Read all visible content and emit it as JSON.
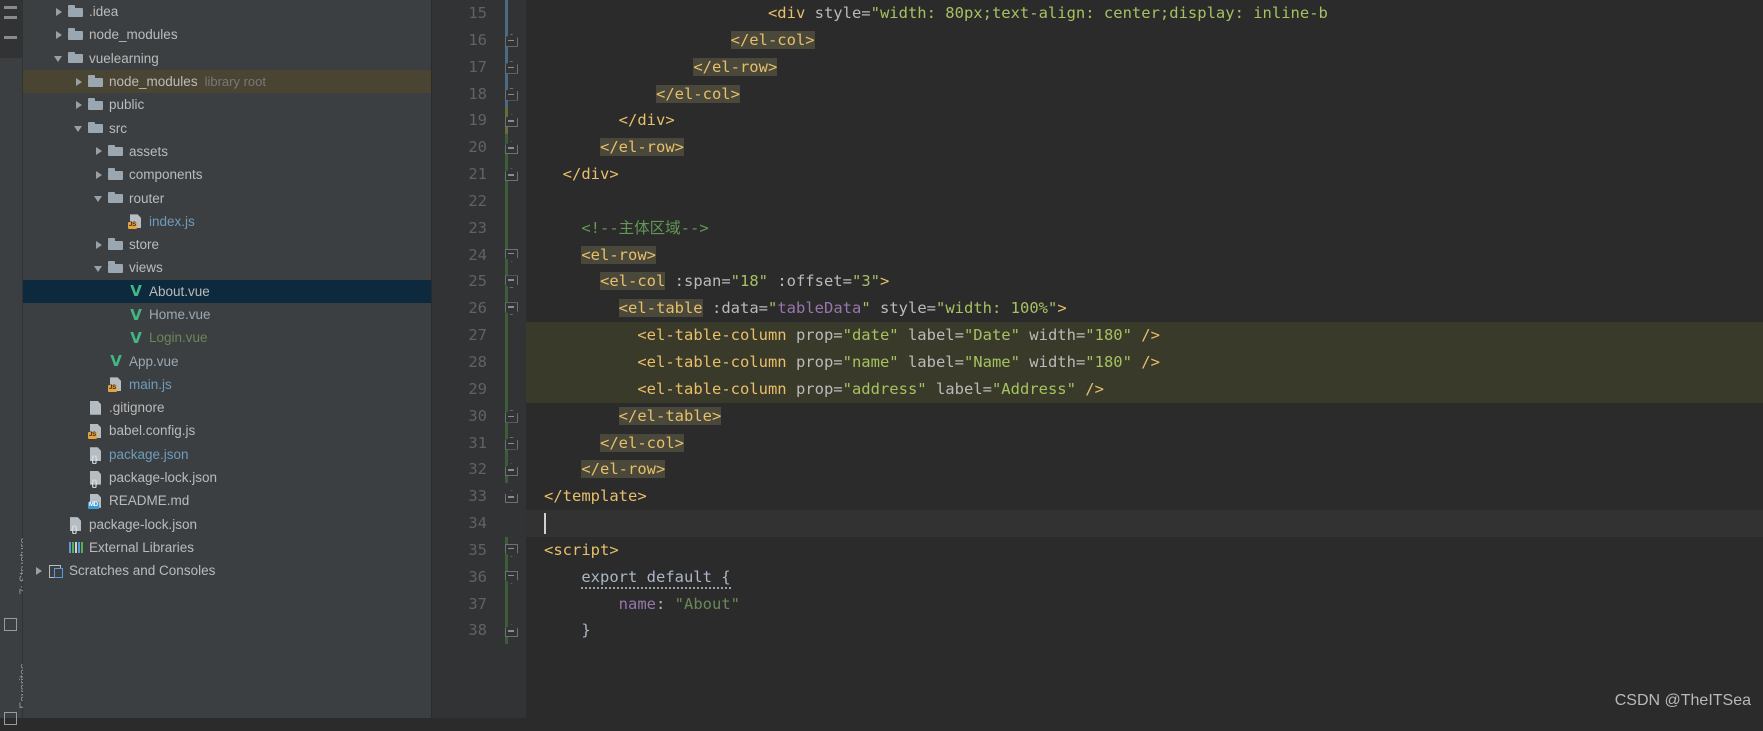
{
  "window": {
    "theme_background": "#3c3f41",
    "editor_background": "#2b2b2b",
    "accent_selection": "#0d293e",
    "accent_library_highlight": "#4a4433"
  },
  "tool_strip": {
    "labels": {
      "structure": "7: Structure",
      "favorites": "Favorites"
    }
  },
  "project_tree": {
    "items": [
      {
        "label": ".idea",
        "sublabel": "",
        "indent": 1,
        "twisty": "right",
        "icon": "folder-icon",
        "color": "default",
        "state": "normal"
      },
      {
        "label": "node_modules",
        "sublabel": "",
        "indent": 1,
        "twisty": "right",
        "icon": "folder-icon",
        "color": "default",
        "state": "normal"
      },
      {
        "label": "vuelearning",
        "sublabel": "",
        "indent": 1,
        "twisty": "down",
        "icon": "folder-icon",
        "color": "default",
        "state": "normal"
      },
      {
        "label": "node_modules",
        "sublabel": "library root",
        "indent": 2,
        "twisty": "right",
        "icon": "folder-icon",
        "color": "default",
        "state": "library"
      },
      {
        "label": "public",
        "sublabel": "",
        "indent": 2,
        "twisty": "right",
        "icon": "folder-icon",
        "color": "default",
        "state": "normal"
      },
      {
        "label": "src",
        "sublabel": "",
        "indent": 2,
        "twisty": "down",
        "icon": "folder-icon",
        "color": "default",
        "state": "normal"
      },
      {
        "label": "assets",
        "sublabel": "",
        "indent": 3,
        "twisty": "right",
        "icon": "folder-icon",
        "color": "default",
        "state": "normal"
      },
      {
        "label": "components",
        "sublabel": "",
        "indent": 3,
        "twisty": "right",
        "icon": "folder-icon",
        "color": "default",
        "state": "normal"
      },
      {
        "label": "router",
        "sublabel": "",
        "indent": 3,
        "twisty": "down",
        "icon": "folder-icon",
        "color": "default",
        "state": "normal"
      },
      {
        "label": "index.js",
        "sublabel": "",
        "indent": 4,
        "twisty": "none",
        "icon": "js-file-icon",
        "color": "blue",
        "state": "normal"
      },
      {
        "label": "store",
        "sublabel": "",
        "indent": 3,
        "twisty": "right",
        "icon": "folder-icon",
        "color": "default",
        "state": "normal"
      },
      {
        "label": "views",
        "sublabel": "",
        "indent": 3,
        "twisty": "down",
        "icon": "folder-icon",
        "color": "default",
        "state": "normal"
      },
      {
        "label": "About.vue",
        "sublabel": "",
        "indent": 4,
        "twisty": "none",
        "icon": "vue-file-icon",
        "color": "teal",
        "state": "selected"
      },
      {
        "label": "Home.vue",
        "sublabel": "",
        "indent": 4,
        "twisty": "none",
        "icon": "vue-file-icon",
        "color": "teal",
        "state": "normal"
      },
      {
        "label": "Login.vue",
        "sublabel": "",
        "indent": 4,
        "twisty": "none",
        "icon": "vue-file-icon",
        "color": "green",
        "state": "normal"
      },
      {
        "label": "App.vue",
        "sublabel": "",
        "indent": 3,
        "twisty": "none",
        "icon": "vue-file-icon",
        "color": "teal",
        "state": "normal"
      },
      {
        "label": "main.js",
        "sublabel": "",
        "indent": 3,
        "twisty": "none",
        "icon": "js-file-icon",
        "color": "blue",
        "state": "normal"
      },
      {
        "label": ".gitignore",
        "sublabel": "",
        "indent": 2,
        "twisty": "none",
        "icon": "file-icon",
        "color": "default",
        "state": "normal"
      },
      {
        "label": "babel.config.js",
        "sublabel": "",
        "indent": 2,
        "twisty": "none",
        "icon": "js-file-icon",
        "color": "default",
        "state": "normal"
      },
      {
        "label": "package.json",
        "sublabel": "",
        "indent": 2,
        "twisty": "none",
        "icon": "json-file-icon",
        "color": "blue",
        "state": "normal"
      },
      {
        "label": "package-lock.json",
        "sublabel": "",
        "indent": 2,
        "twisty": "none",
        "icon": "json-file-icon",
        "color": "default",
        "state": "normal"
      },
      {
        "label": "README.md",
        "sublabel": "",
        "indent": 2,
        "twisty": "none",
        "icon": "md-file-icon",
        "color": "default",
        "state": "normal"
      },
      {
        "label": "package-lock.json",
        "sublabel": "",
        "indent": 1,
        "twisty": "none",
        "icon": "json-file-icon",
        "color": "default",
        "state": "normal"
      },
      {
        "label": "External Libraries",
        "sublabel": "",
        "indent": 1,
        "twisty": "none",
        "icon": "libraries-icon",
        "color": "default",
        "state": "normal"
      },
      {
        "label": "Scratches and Consoles",
        "sublabel": "",
        "indent": 0,
        "twisty": "right",
        "icon": "scratches-icon",
        "color": "default",
        "state": "normal"
      }
    ]
  },
  "editor": {
    "first_line_number": 15,
    "current_line": 34,
    "caret_line": 34,
    "lines": [
      {
        "no": 15,
        "fold": "none",
        "rail": "blue",
        "tokens": [
          {
            "t": "                        ",
            "c": "plain"
          },
          {
            "t": "<div",
            "c": "tag"
          },
          {
            "t": " style=",
            "c": "attr"
          },
          {
            "t": "\"width: 80px;text-align: center;display: inline-b",
            "c": "str"
          }
        ]
      },
      {
        "no": 16,
        "fold": "down",
        "rail": "blue",
        "tokens": [
          {
            "t": "                    ",
            "c": "plain"
          },
          {
            "t": "</el-col>",
            "c": "tag",
            "hl": true
          }
        ]
      },
      {
        "no": 17,
        "fold": "down",
        "rail": "blue",
        "tokens": [
          {
            "t": "                ",
            "c": "plain"
          },
          {
            "t": "</el-row>",
            "c": "tag",
            "hl": true
          }
        ]
      },
      {
        "no": 18,
        "fold": "down",
        "rail": "blue",
        "tokens": [
          {
            "t": "            ",
            "c": "plain"
          },
          {
            "t": "</el-col>",
            "c": "tag",
            "hl": true
          }
        ]
      },
      {
        "no": 19,
        "fold": "down",
        "rail": "olive",
        "tokens": [
          {
            "t": "        ",
            "c": "plain"
          },
          {
            "t": "</div>",
            "c": "tag"
          }
        ]
      },
      {
        "no": 20,
        "fold": "down",
        "rail": "green",
        "tokens": [
          {
            "t": "      ",
            "c": "plain"
          },
          {
            "t": "</el-row>",
            "c": "tag",
            "hl": true
          }
        ]
      },
      {
        "no": 21,
        "fold": "down",
        "rail": "green",
        "tokens": [
          {
            "t": "  ",
            "c": "plain"
          },
          {
            "t": "</div>",
            "c": "tag"
          }
        ]
      },
      {
        "no": 22,
        "fold": "none",
        "rail": "green",
        "tokens": []
      },
      {
        "no": 23,
        "fold": "none",
        "rail": "green",
        "tokens": [
          {
            "t": "    ",
            "c": "plain"
          },
          {
            "t": "<!--主体区域-->",
            "c": "cmt"
          }
        ]
      },
      {
        "no": 24,
        "fold": "up",
        "rail": "green",
        "tokens": [
          {
            "t": "    ",
            "c": "plain"
          },
          {
            "t": "<el-row>",
            "c": "tag",
            "hl": true
          }
        ]
      },
      {
        "no": 25,
        "fold": "up",
        "rail": "green",
        "tokens": [
          {
            "t": "      ",
            "c": "plain"
          },
          {
            "t": "<el-col",
            "c": "tag",
            "hl": true
          },
          {
            "t": " :span=",
            "c": "attr"
          },
          {
            "t": "\"18\"",
            "c": "str"
          },
          {
            "t": " :offset=",
            "c": "attr"
          },
          {
            "t": "\"3\"",
            "c": "str"
          },
          {
            "t": ">",
            "c": "tag"
          }
        ]
      },
      {
        "no": 26,
        "fold": "up",
        "rail": "green",
        "tokens": [
          {
            "t": "        ",
            "c": "plain"
          },
          {
            "t": "<el-table",
            "c": "tag",
            "hl": true
          },
          {
            "t": " :data=",
            "c": "attr"
          },
          {
            "t": "\"",
            "c": "str"
          },
          {
            "t": "tableData",
            "c": "expr"
          },
          {
            "t": "\"",
            "c": "str"
          },
          {
            "t": " style=",
            "c": "attr"
          },
          {
            "t": "\"width: 100%\"",
            "c": "str"
          },
          {
            "t": ">",
            "c": "tag"
          }
        ]
      },
      {
        "no": 27,
        "fold": "none",
        "rail": "green",
        "hl_full": true,
        "tokens": [
          {
            "t": "          ",
            "c": "plain"
          },
          {
            "t": "<el-table-column",
            "c": "tag"
          },
          {
            "t": " prop=",
            "c": "attr"
          },
          {
            "t": "\"date\"",
            "c": "str"
          },
          {
            "t": " label=",
            "c": "attr"
          },
          {
            "t": "\"Date\"",
            "c": "str"
          },
          {
            "t": " width=",
            "c": "attr"
          },
          {
            "t": "\"180\"",
            "c": "str"
          },
          {
            "t": " />",
            "c": "tag"
          }
        ]
      },
      {
        "no": 28,
        "fold": "none",
        "rail": "green",
        "hl_full": true,
        "tokens": [
          {
            "t": "          ",
            "c": "plain"
          },
          {
            "t": "<el-table-column",
            "c": "tag"
          },
          {
            "t": " prop=",
            "c": "attr"
          },
          {
            "t": "\"name\"",
            "c": "str"
          },
          {
            "t": " label=",
            "c": "attr"
          },
          {
            "t": "\"Name\"",
            "c": "str"
          },
          {
            "t": " width=",
            "c": "attr"
          },
          {
            "t": "\"180\"",
            "c": "str"
          },
          {
            "t": " />",
            "c": "tag"
          }
        ]
      },
      {
        "no": 29,
        "fold": "none",
        "rail": "green",
        "hl_full": true,
        "tokens": [
          {
            "t": "          ",
            "c": "plain"
          },
          {
            "t": "<el-table-column",
            "c": "tag"
          },
          {
            "t": " prop=",
            "c": "attr"
          },
          {
            "t": "\"address\"",
            "c": "str"
          },
          {
            "t": " label=",
            "c": "attr"
          },
          {
            "t": "\"Address\"",
            "c": "str"
          },
          {
            "t": " />",
            "c": "tag"
          }
        ]
      },
      {
        "no": 30,
        "fold": "down",
        "rail": "green",
        "tokens": [
          {
            "t": "        ",
            "c": "plain"
          },
          {
            "t": "</el-table>",
            "c": "tag",
            "hl": true
          }
        ]
      },
      {
        "no": 31,
        "fold": "down",
        "rail": "green",
        "tokens": [
          {
            "t": "      ",
            "c": "plain"
          },
          {
            "t": "</el-col>",
            "c": "tag",
            "hl": true
          }
        ]
      },
      {
        "no": 32,
        "fold": "down",
        "rail": "green",
        "tokens": [
          {
            "t": "    ",
            "c": "plain"
          },
          {
            "t": "</el-row>",
            "c": "tag",
            "hl": true
          }
        ]
      },
      {
        "no": 33,
        "fold": "down",
        "rail": "none",
        "tokens": [
          {
            "t": "</template>",
            "c": "tag"
          }
        ]
      },
      {
        "no": 34,
        "fold": "none",
        "rail": "none",
        "current": true,
        "tokens": []
      },
      {
        "no": 35,
        "fold": "up",
        "rail": "green",
        "tokens": [
          {
            "t": "<script>",
            "c": "tag"
          }
        ]
      },
      {
        "no": 36,
        "fold": "up",
        "rail": "green",
        "tokens": [
          {
            "t": "    ",
            "c": "plain"
          },
          {
            "t": "export default {",
            "c": "plain",
            "squiggle": true
          }
        ]
      },
      {
        "no": 37,
        "fold": "none",
        "rail": "green",
        "tokens": [
          {
            "t": "        ",
            "c": "plain"
          },
          {
            "t": "name",
            "c": "expr"
          },
          {
            "t": ": ",
            "c": "plain"
          },
          {
            "t": "\"About\"",
            "c": "strv"
          }
        ]
      },
      {
        "no": 38,
        "fold": "down",
        "rail": "green",
        "tokens": [
          {
            "t": "    ",
            "c": "plain"
          },
          {
            "t": "}",
            "c": "plain"
          }
        ]
      }
    ]
  },
  "watermark": {
    "text": "CSDN @TheITSea"
  }
}
